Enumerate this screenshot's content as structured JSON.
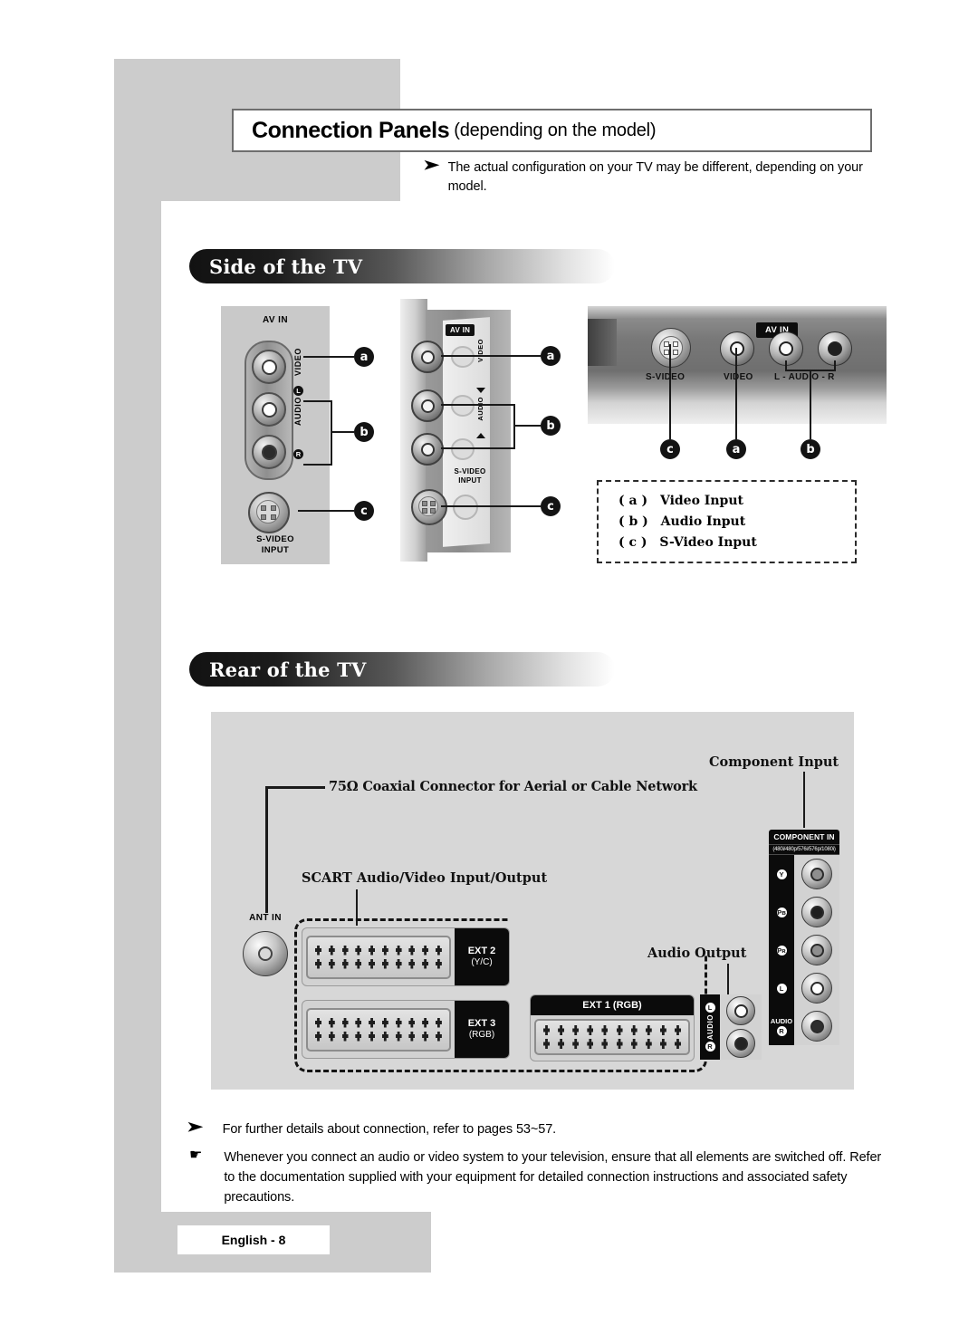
{
  "header": {
    "title_main": "Connection Panels",
    "title_sub": "(depending on the model)",
    "note_bullet": "➤",
    "note_text": "The actual configuration on your TV may be different, depending on your model."
  },
  "sections": {
    "side": {
      "heading": "Side of the TV"
    },
    "rear": {
      "heading": "Rear of the TV"
    }
  },
  "side_panel_1": {
    "av_in": "AV IN",
    "video_label": "VIDEO",
    "audio_label": "AUDIO",
    "badge_l": "L",
    "badge_r": "R",
    "svideo_label": "S-VIDEO\nINPUT"
  },
  "side_panel_2": {
    "av_in": "AV IN",
    "video_label": "VIDEO",
    "audio_label": "AUDIO",
    "svideo_label": "S-VIDEO\nINPUT"
  },
  "side_panel_3": {
    "av_in": "AV IN",
    "svideo_label": "S-VIDEO",
    "video_label": "VIDEO",
    "audio_label": "L - AUDIO - R"
  },
  "callouts": {
    "a": "a",
    "b": "b",
    "c": "c"
  },
  "legend": {
    "rows": [
      {
        "key": "( a )",
        "text": "Video Input"
      },
      {
        "key": "( b )",
        "text": "Audio Input"
      },
      {
        "key": "( c )",
        "text": "S-Video Input"
      }
    ]
  },
  "rear": {
    "coax_label": "75Ω Coaxial Connector for Aerial or Cable Network",
    "scart_label": "SCART Audio/Video Input/Output",
    "component_label": "Component Input",
    "audio_output_label": "Audio Output",
    "ant_in": "ANT IN",
    "scarts": [
      {
        "name": "EXT 2",
        "sub": "(Y/C)"
      },
      {
        "name": "EXT 3",
        "sub": "(RGB)"
      }
    ],
    "scart1": {
      "name": "EXT 1 (RGB)"
    },
    "audio_out": {
      "l": "L",
      "r": "R",
      "word": "AUDIO"
    },
    "component": {
      "title": "COMPONENT IN",
      "resolutions": "(480i/480p/576i/576p/1080i)",
      "rows": [
        {
          "tag": "Y"
        },
        {
          "tag": "Pʙ"
        },
        {
          "tag": "Pʀ"
        },
        {
          "tag": "L"
        },
        {
          "tag": "R"
        }
      ],
      "audio_word": "AUDIO"
    }
  },
  "footer": {
    "note1_bullet": "➤",
    "note1": "For further details about connection, refer to pages 53~57.",
    "note2_bullet": "☛",
    "note2": "Whenever you connect an audio or video system to your television, ensure that all elements are switched off. Refer to the documentation supplied with your equipment  for detailed connection instructions and associated safety precautions.",
    "page": "English - 8"
  },
  "colors": {
    "page_gray": "#cccccc",
    "panel_gray": "#d7d7d7",
    "ink": "#111111"
  }
}
